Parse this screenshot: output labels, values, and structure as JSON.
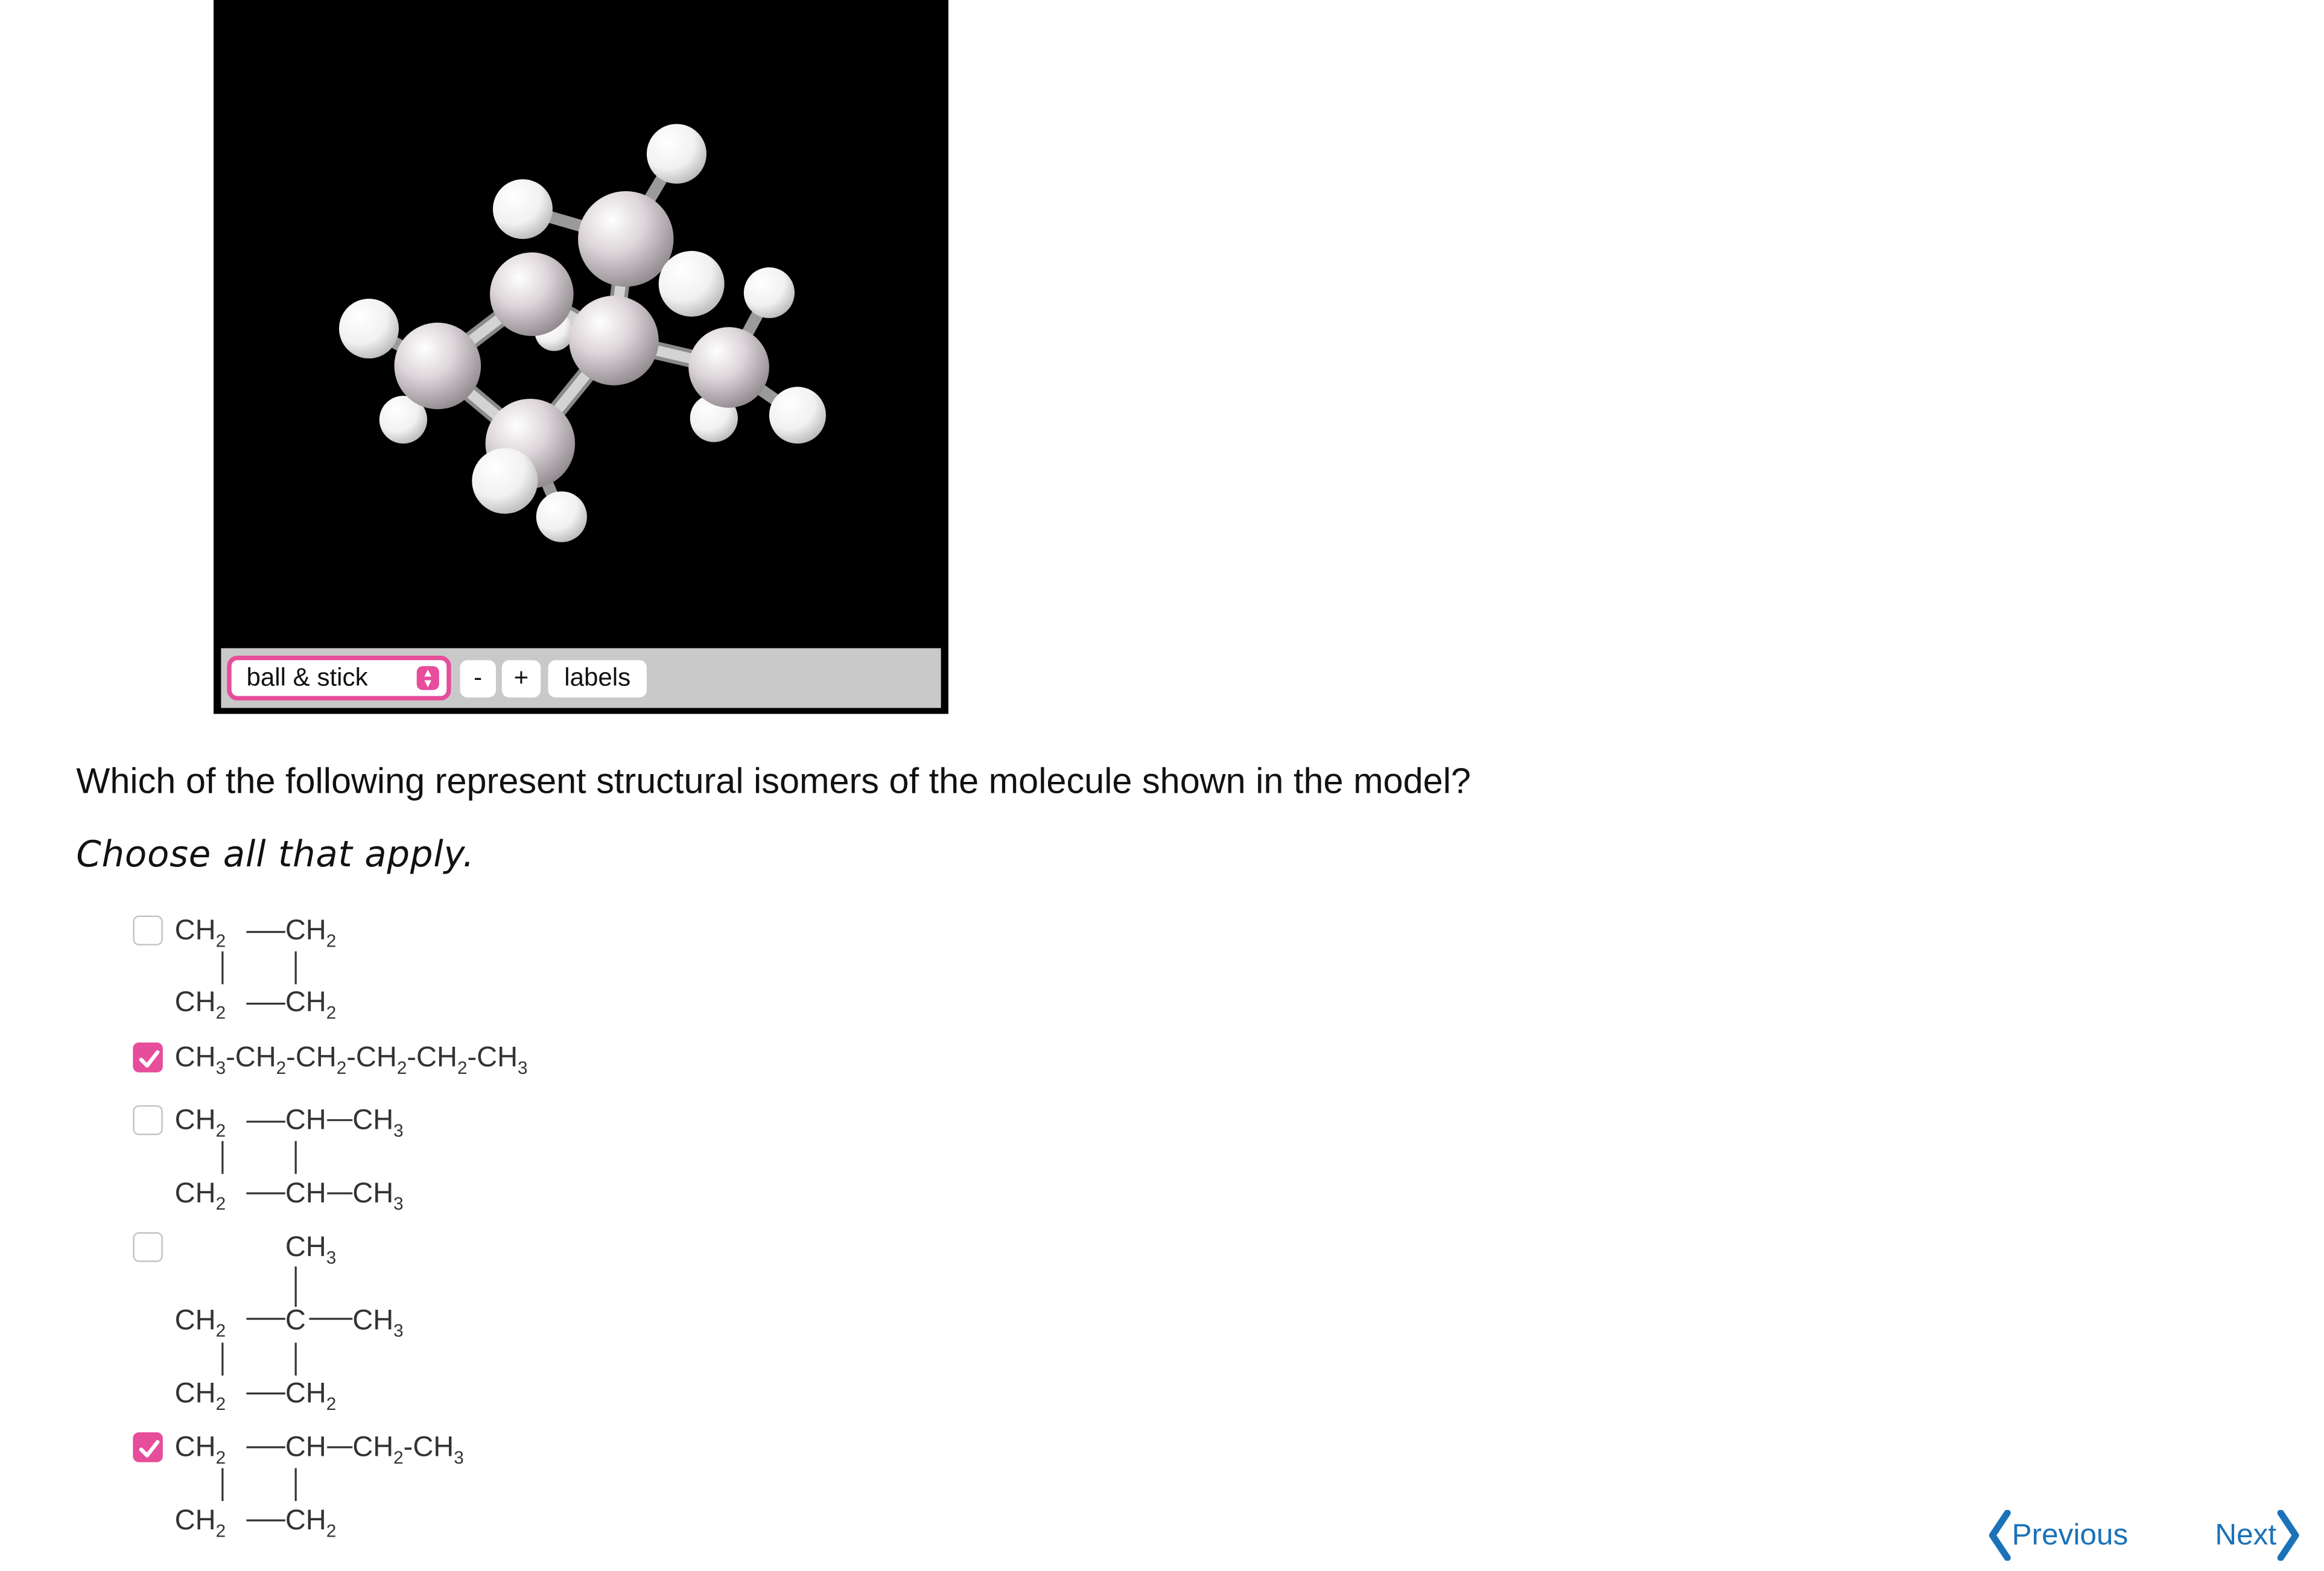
{
  "viewer": {
    "style_select": "ball & stick",
    "zoom_out_label": "-",
    "zoom_in_label": "+",
    "labels_label": "labels"
  },
  "question": "Which of the following represent structural isomers of the molecule shown in the model?",
  "instruction": "Choose all that apply.",
  "options": [
    {
      "checked": false,
      "formula": "CH2-CH2 / CH2-CH2 (cyclobutane)"
    },
    {
      "checked": true,
      "formula": "CH3-CH2-CH2-CH2-CH2-CH3"
    },
    {
      "checked": false,
      "formula": "CH2-CH-CH3 / CH2-CH-CH3 (1,2-dimethylcyclobutane)"
    },
    {
      "checked": false,
      "formula": "CH3 / CH2-C-CH3 / CH2-CH2 (1,1-dimethylcyclobutane)"
    },
    {
      "checked": true,
      "formula": "CH2-CH-CH2-CH3 / CH2-CH2 (ethylcyclobutane)"
    }
  ],
  "nav": {
    "previous_label": "Previous",
    "next_label": "Next"
  },
  "colors": {
    "accent": "#e64d9b",
    "link": "#1b72b8",
    "viewer_background": "#000000",
    "toolbar": "#c9c9c9"
  }
}
